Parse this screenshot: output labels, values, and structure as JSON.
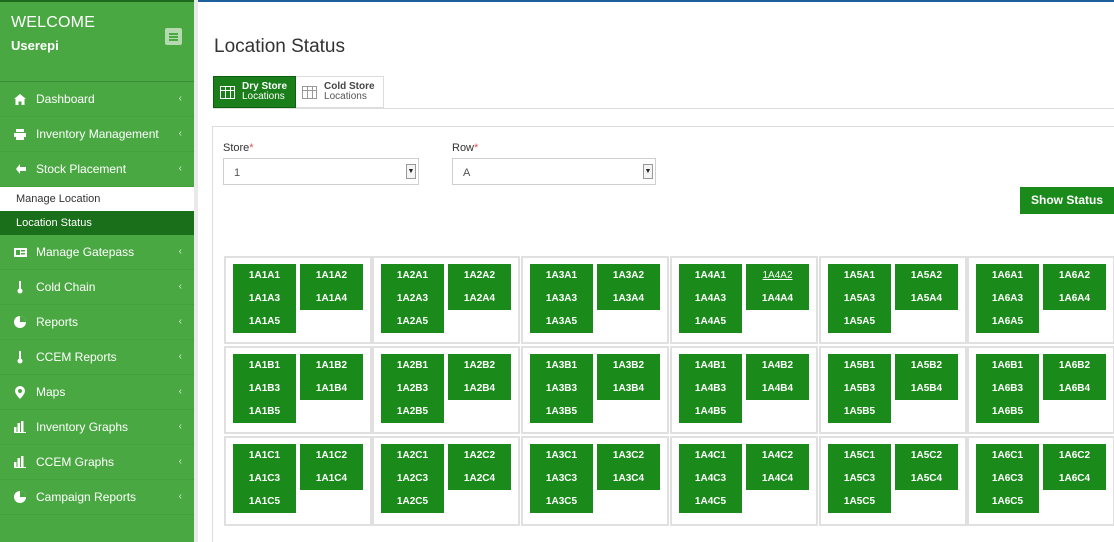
{
  "sidebar": {
    "welcome": "WELCOME",
    "user": "Userepi",
    "items": [
      {
        "label": "Dashboard",
        "icon": "home-icon"
      },
      {
        "label": "Inventory Management",
        "icon": "inventory-icon"
      },
      {
        "label": "Stock Placement",
        "icon": "stock-placement-icon"
      },
      {
        "label": "Manage Gatepass",
        "icon": "gatepass-icon"
      },
      {
        "label": "Cold Chain",
        "icon": "cold-chain-icon"
      },
      {
        "label": "Reports",
        "icon": "reports-icon"
      },
      {
        "label": "CCEM Reports",
        "icon": "ccem-reports-icon"
      },
      {
        "label": "Maps",
        "icon": "maps-icon"
      },
      {
        "label": "Inventory Graphs",
        "icon": "bar-chart-icon"
      },
      {
        "label": "CCEM Graphs",
        "icon": "bar-chart-icon"
      },
      {
        "label": "Campaign Reports",
        "icon": "campaign-reports-icon"
      }
    ],
    "subitems": [
      "Manage Location",
      "Location Status"
    ]
  },
  "page": {
    "title": "Location Status"
  },
  "tabs": [
    {
      "line1": "Dry Store",
      "line2": "Locations"
    },
    {
      "line1": "Cold Store",
      "line2": "Locations"
    }
  ],
  "form": {
    "store_label": "Store",
    "row_label": "Row",
    "required_mark": "*",
    "store_value": "1",
    "row_value": "A",
    "show_button": "Show Status"
  },
  "locations": {
    "stores": [
      1,
      2,
      3,
      4,
      5,
      6
    ],
    "rows": [
      "A",
      "B",
      "C"
    ],
    "positions": [
      1,
      2,
      3,
      4,
      5
    ],
    "underlined": "1A4A2"
  },
  "colors": {
    "sidebar_bg": "#4aa842",
    "active_green": "#1a8a1a",
    "dark_green": "#1a6f1a"
  }
}
